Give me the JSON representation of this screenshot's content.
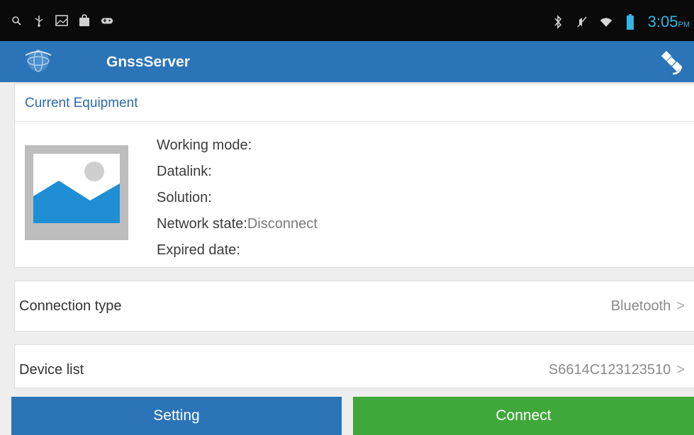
{
  "status_bar": {
    "left_icons": [
      "search-icon",
      "usb-icon",
      "image-icon",
      "shop-icon",
      "gamepad-icon"
    ],
    "right_icons": [
      "bluetooth-icon",
      "mute-icon",
      "wifi-icon",
      "battery-icon"
    ],
    "time": "3:05",
    "ampm": "PM",
    "time_color": "#33b5e5"
  },
  "app_bar": {
    "title": "GnssServer",
    "color": "#2a74b7",
    "logo_icon": "globe-logo-icon",
    "action_icon": "satellite-icon"
  },
  "current_equipment": {
    "title": "Current Equipment",
    "image_icon": "image-placeholder-icon",
    "fields": [
      {
        "label": "Working mode:",
        "value": ""
      },
      {
        "label": "Datalink:",
        "value": ""
      },
      {
        "label": "Solution:",
        "value": ""
      },
      {
        "label": "Network state:",
        "value": "Disconnect"
      },
      {
        "label": "Expired date:",
        "value": ""
      }
    ]
  },
  "connection_type": {
    "label": "Connection type",
    "value": "Bluetooth",
    "chevron": ">"
  },
  "device_list": {
    "label": "Device list",
    "value": "S6614C123123510",
    "chevron": ">"
  },
  "buttons": {
    "setting": "Setting",
    "connect": "Connect",
    "setting_color": "#2a74b7",
    "connect_color": "#3fa83a"
  }
}
